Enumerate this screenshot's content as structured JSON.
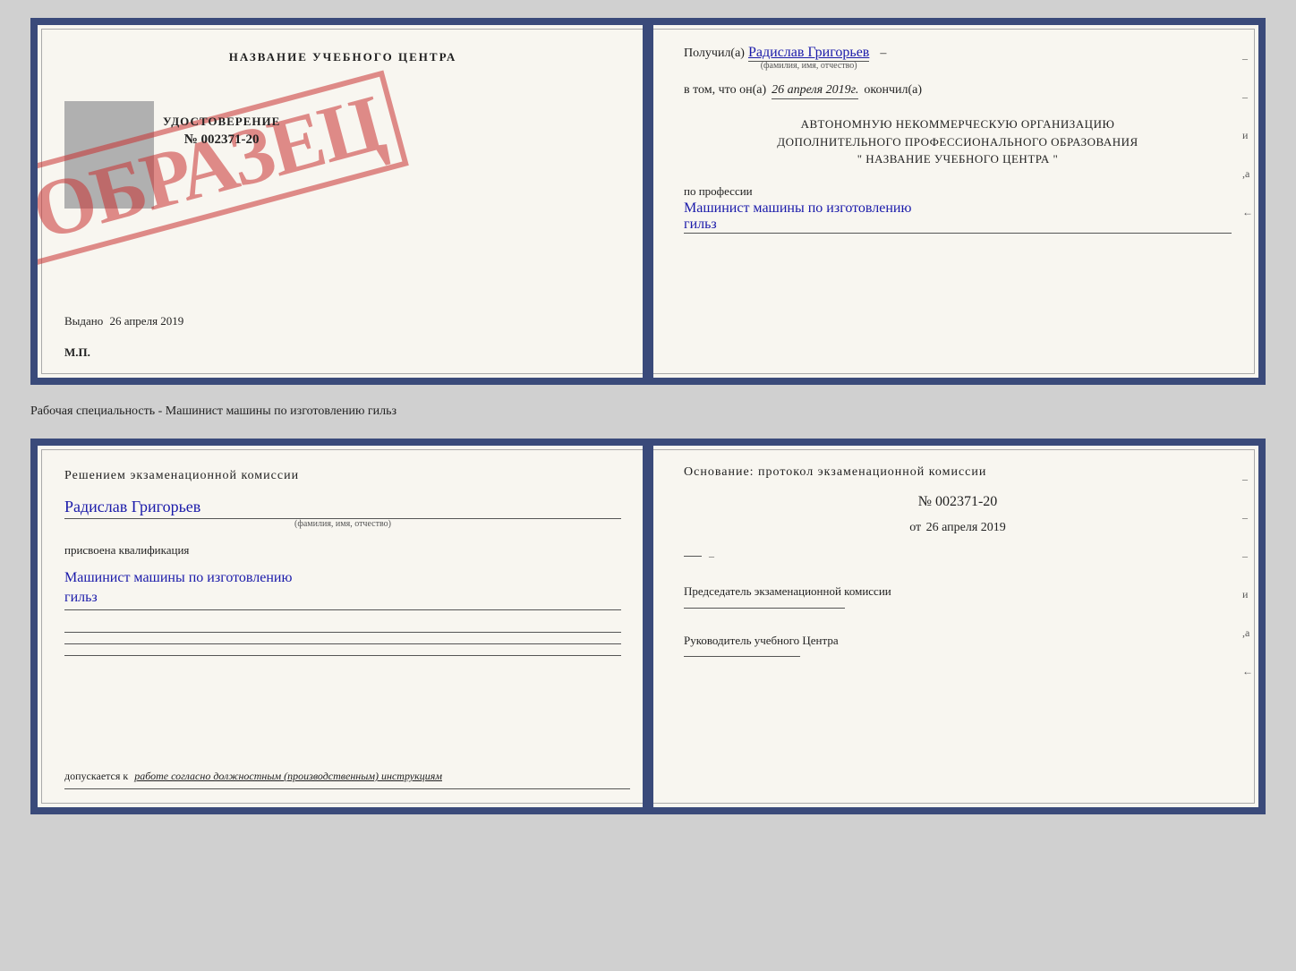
{
  "top_doc": {
    "left": {
      "school_name": "НАЗВАНИЕ УЧЕБНОГО ЦЕНТРА",
      "stamp_text": "ОБРАЗЕЦ",
      "udostoverenie_title": "УДОСТОВЕРЕНИЕ",
      "udostoverenie_num": "№ 002371-20",
      "vydano_label": "Выдано",
      "vydano_date": "26 апреля 2019",
      "mp_label": "М.П."
    },
    "right": {
      "received_label": "Получил(а)",
      "received_name": "Радислав Григорьев",
      "received_sub": "(фамилия, имя, отчество)",
      "vtom_label": "в том, что он(а)",
      "vtom_date": "26 апреля 2019г.",
      "okoncil_label": "окончил(а)",
      "org_line1": "АВТОНОМНУЮ НЕКОММЕРЧЕСКУЮ ОРГАНИЗАЦИЮ",
      "org_line2": "ДОПОЛНИТЕЛЬНОГО ПРОФЕССИОНАЛЬНОГО ОБРАЗОВАНИЯ",
      "org_line3": "\"   НАЗВАНИЕ УЧЕБНОГО ЦЕНТРА   \"",
      "profession_label": "по профессии",
      "profession_value": "Машинист машины по изготовлению",
      "profession_value2": "гильз",
      "dash1": "–",
      "dash2": "–",
      "mark_i": "и",
      "mark_a": ",а",
      "mark_arrow": "←"
    }
  },
  "subtitle": "Рабочая специальность - Машинист машины по изготовлению гильз",
  "bottom_doc": {
    "left": {
      "commission_title": "Решением  экзаменационной  комиссии",
      "person_name": "Радислав Григорьев",
      "person_name_sub": "(фамилия, имя, отчество)",
      "assigned_label": "присвоена квалификация",
      "qualification_line1": "Машинист машины по изготовлению",
      "qualification_line2": "гильз",
      "допускается_label": "допускается к",
      "допускается_value": "работе согласно должностным (производственным) инструкциям"
    },
    "right": {
      "osnov_title": "Основание: протокол экзаменационной  комиссии",
      "protocol_num": "№  002371-20",
      "protocol_date_prefix": "от",
      "protocol_date": "26 апреля 2019",
      "chairman_title": "Председатель экзаменационной комиссии",
      "rukovoditel_title": "Руководитель учебного Центра",
      "dash1": "–",
      "dash2": "–",
      "dash3": "–",
      "mark_i": "и",
      "mark_a": ",а",
      "mark_arrow": "←"
    }
  }
}
